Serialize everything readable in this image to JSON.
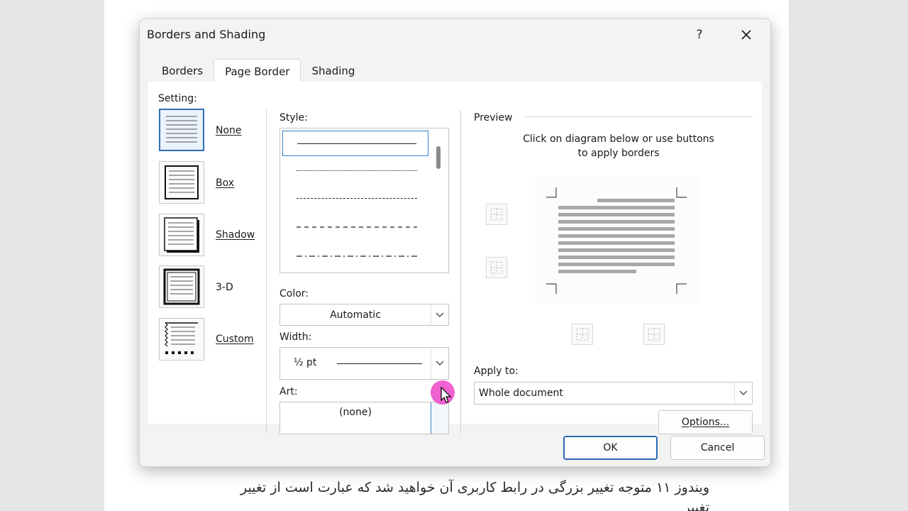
{
  "document": {
    "line1": "ویندوز ۱۱ متوجه تغییر بزرگی در رابط کاربری آن خواهید شد که عبارت است از تغییر",
    "line2": "تغییر"
  },
  "dialog": {
    "title": "Borders and Shading",
    "help_label": "?",
    "tabs": [
      {
        "label": "Borders",
        "active": false
      },
      {
        "label": "Page Border",
        "active": true
      },
      {
        "label": "Shading",
        "active": false
      }
    ],
    "setting": {
      "label": "Setting:",
      "options": [
        {
          "label": "None",
          "selected": true
        },
        {
          "label": "Box",
          "selected": false
        },
        {
          "label": "Shadow",
          "selected": false
        },
        {
          "label": "3-D",
          "selected": false
        },
        {
          "label": "Custom",
          "selected": false
        }
      ]
    },
    "style": {
      "label": "Style:",
      "items": [
        "solid",
        "dotted",
        "dense-dashed",
        "dashed",
        "dash-dot"
      ]
    },
    "color": {
      "label": "Color:",
      "value": "Automatic"
    },
    "width": {
      "label": "Width:",
      "value": "½ pt"
    },
    "art": {
      "label": "Art:",
      "value": "(none)"
    },
    "preview": {
      "label": "Preview",
      "hint_line1": "Click on diagram below or use buttons",
      "hint_line2": "to apply borders"
    },
    "apply_to": {
      "label": "Apply to:",
      "value": "Whole document"
    },
    "options_label": "Options...",
    "ok_label": "OK",
    "cancel_label": "Cancel"
  },
  "colors": {
    "accent": "#2b68b4",
    "cursor_highlight": "#ec46c8"
  }
}
